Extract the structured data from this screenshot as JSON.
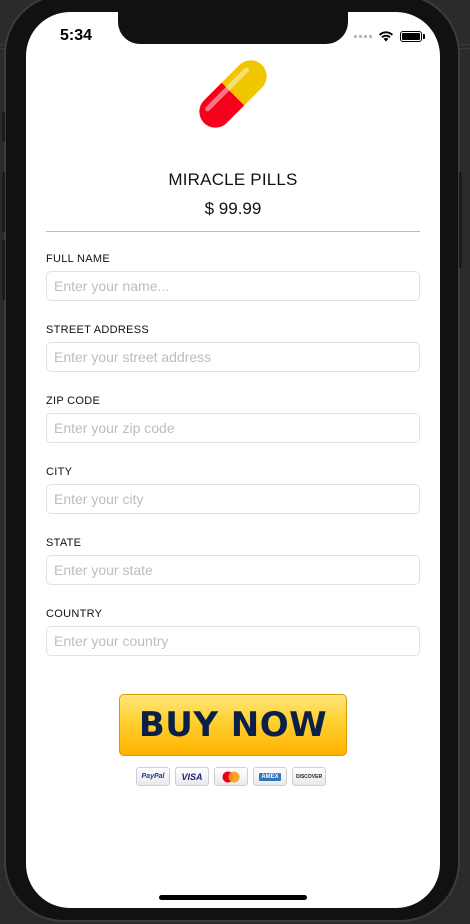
{
  "status_bar": {
    "time": "5:34"
  },
  "product": {
    "name": "MIRACLE PILLS",
    "price": "$ 99.99"
  },
  "form": {
    "fields": [
      {
        "label": "FULL NAME",
        "placeholder": "Enter your name..."
      },
      {
        "label": "STREET ADDRESS",
        "placeholder": "Enter your street address"
      },
      {
        "label": "ZIP CODE",
        "placeholder": "Enter your zip code"
      },
      {
        "label": "CITY",
        "placeholder": "Enter your city"
      },
      {
        "label": "STATE",
        "placeholder": "Enter your state"
      },
      {
        "label": "COUNTRY",
        "placeholder": "Enter your country"
      }
    ]
  },
  "buy_button": {
    "label": "BUY NOW"
  },
  "payment_cards": [
    {
      "name": "paypal-card-icon",
      "label": "PayPal",
      "color": "#1a3a8b"
    },
    {
      "name": "visa-card-icon",
      "label": "VISA",
      "color": "#1a1f71"
    },
    {
      "name": "mastercard-card-icon",
      "label": "",
      "color": "#eb001b"
    },
    {
      "name": "amex-card-icon",
      "label": "AMEX",
      "color": "#2e77bb"
    },
    {
      "name": "discover-card-icon",
      "label": "DISCOVER",
      "color": "#e65c00"
    }
  ],
  "colors": {
    "pill_red": "#f5001a",
    "pill_yellow": "#f0c600",
    "button_text": "#0b2049"
  }
}
